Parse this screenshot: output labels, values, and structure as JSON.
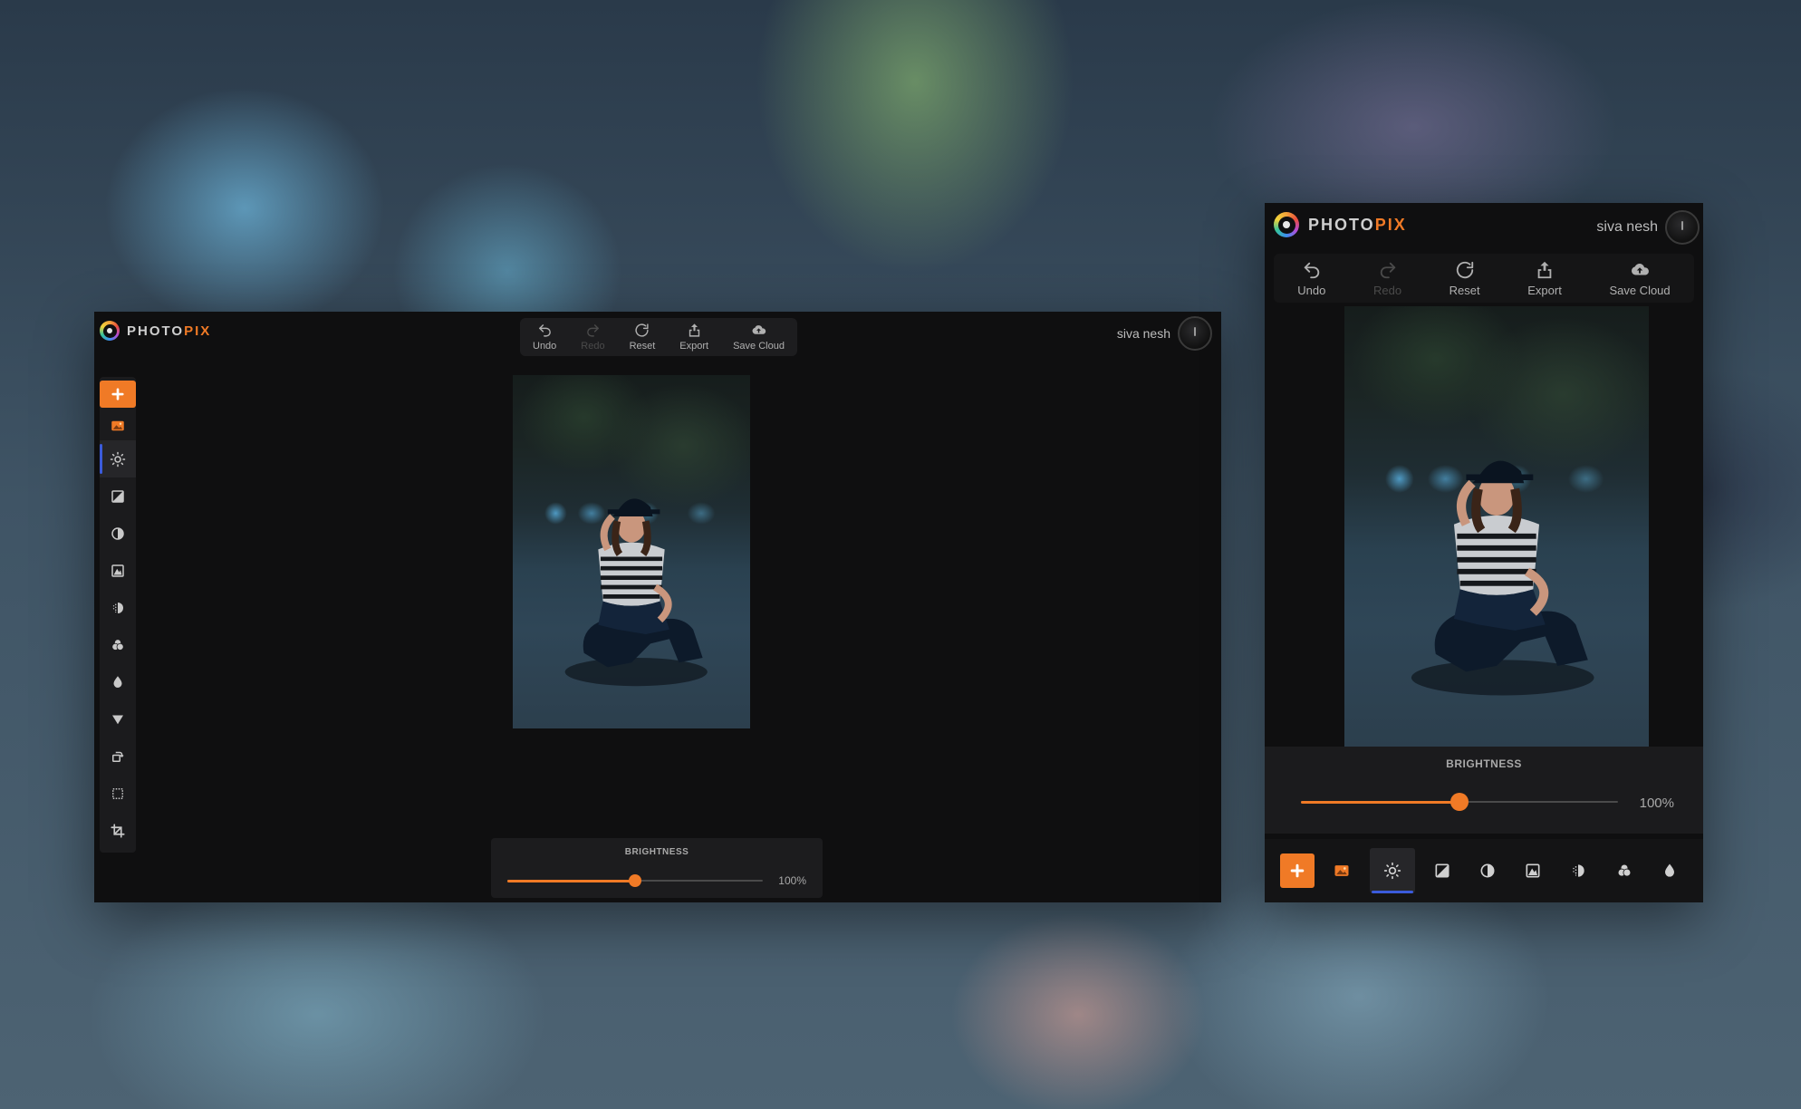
{
  "app": {
    "logo_prefix": "PHOTO",
    "logo_suffix": "PIX",
    "accent_color": "#f07a26",
    "active_indicator_color": "#3b5bdb"
  },
  "toolbar": {
    "undo_label": "Undo",
    "redo_label": "Redo",
    "reset_label": "Reset",
    "export_label": "Export",
    "save_cloud_label": "Save Cloud"
  },
  "user": {
    "name": "siva nesh"
  },
  "tools": {
    "add": "plus-icon",
    "gallery": "image-gallery-icon",
    "brightness": "sun-icon",
    "exposure": "exposure-icon",
    "contrast": "half-circle-icon",
    "levels": "levels-icon",
    "grain": "dots-icon",
    "color": "color-blend-icon",
    "saturation": "drop-icon",
    "vignette": "triangle-down-icon",
    "rotate": "rotate-icon",
    "select": "dotted-square-icon",
    "crop": "crop-icon",
    "active": "brightness"
  },
  "adjustment": {
    "label": "BRIGHTNESS",
    "value_text": "100%",
    "slider_fraction": 0.5
  }
}
